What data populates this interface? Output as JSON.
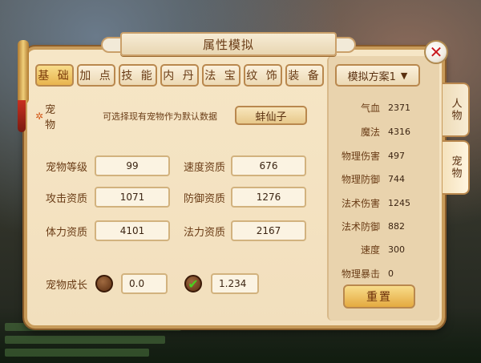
{
  "window": {
    "title": "属性模拟"
  },
  "tabs": [
    {
      "label": "基 础",
      "active": true
    },
    {
      "label": "加 点",
      "active": false
    },
    {
      "label": "技 能",
      "active": false
    },
    {
      "label": "内 丹",
      "active": false
    },
    {
      "label": "法 宝",
      "active": false
    },
    {
      "label": "纹 饰",
      "active": false
    },
    {
      "label": "装 备",
      "active": false
    }
  ],
  "scheme": {
    "selected": "模拟方案1"
  },
  "side_tabs": [
    {
      "label": "人物",
      "active": false
    },
    {
      "label": "宠物",
      "active": true
    }
  ],
  "pet": {
    "label": "宠 物",
    "hint": "可选择现有宠物作为默认数据",
    "selected": "蚌仙子"
  },
  "fields": [
    {
      "label": "宠物等级",
      "value": "99"
    },
    {
      "label": "速度资质",
      "value": "676"
    },
    {
      "label": "攻击资质",
      "value": "1071"
    },
    {
      "label": "防御资质",
      "value": "1276"
    },
    {
      "label": "体力资质",
      "value": "4101"
    },
    {
      "label": "法力资质",
      "value": "2167"
    }
  ],
  "growth": {
    "label": "宠物成长",
    "value_a": "0.0",
    "value_b": "1.234",
    "checked": true
  },
  "stats": [
    {
      "label": "气血",
      "value": "2371"
    },
    {
      "label": "魔法",
      "value": "4316"
    },
    {
      "label": "物理伤害",
      "value": "497"
    },
    {
      "label": "物理防御",
      "value": "744"
    },
    {
      "label": "法术伤害",
      "value": "1245"
    },
    {
      "label": "法术防御",
      "value": "882"
    },
    {
      "label": "速度",
      "value": "300"
    },
    {
      "label": "物理暴击",
      "value": "0"
    }
  ],
  "buttons": {
    "reset": "重置"
  },
  "icons": {
    "close": "close-icon",
    "dropdown": "chevron-down-icon",
    "check": "check-icon"
  },
  "colors": {
    "accent": "#e8b44e",
    "close": "#c8181e",
    "check": "#4ad020"
  }
}
